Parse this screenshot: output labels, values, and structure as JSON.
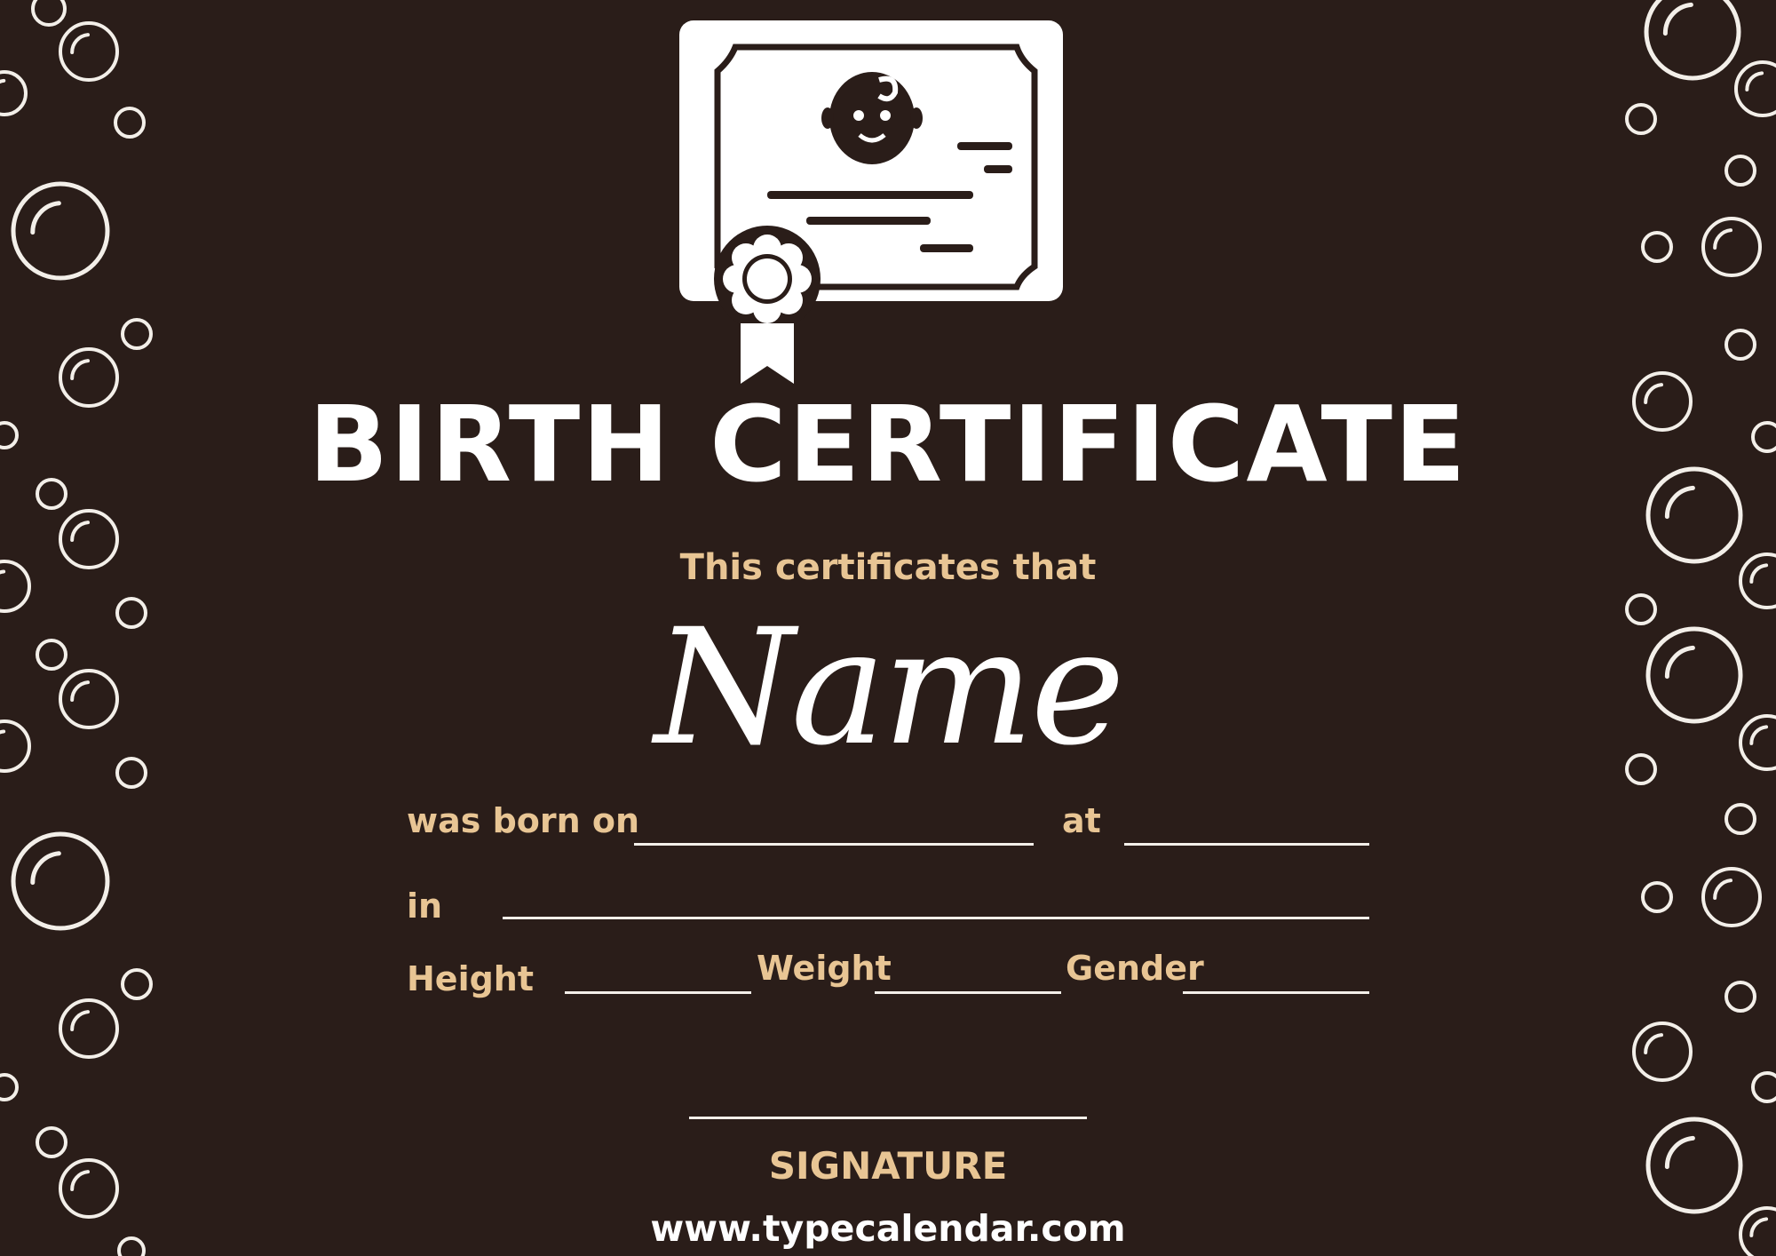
{
  "certificate": {
    "title": "BIRTH CERTIFICATE",
    "subtitle": "This certificates that",
    "name_placeholder": "Name"
  },
  "fields": {
    "born_on_label": "was born on",
    "at_label": "at",
    "in_label": "in",
    "height_label": "Height",
    "weight_label": "Weight",
    "gender_label": "Gender"
  },
  "signature": {
    "label": "SIGNATURE"
  },
  "footer": {
    "website": "www.typecalendar.com"
  },
  "colors": {
    "background": "#2a1d19",
    "text_primary": "#ffffff",
    "text_accent": "#e8c594",
    "lines": "#f3efe9"
  },
  "icons": {
    "header": "certificate-baby-icon",
    "decor": "bubble-icon"
  }
}
